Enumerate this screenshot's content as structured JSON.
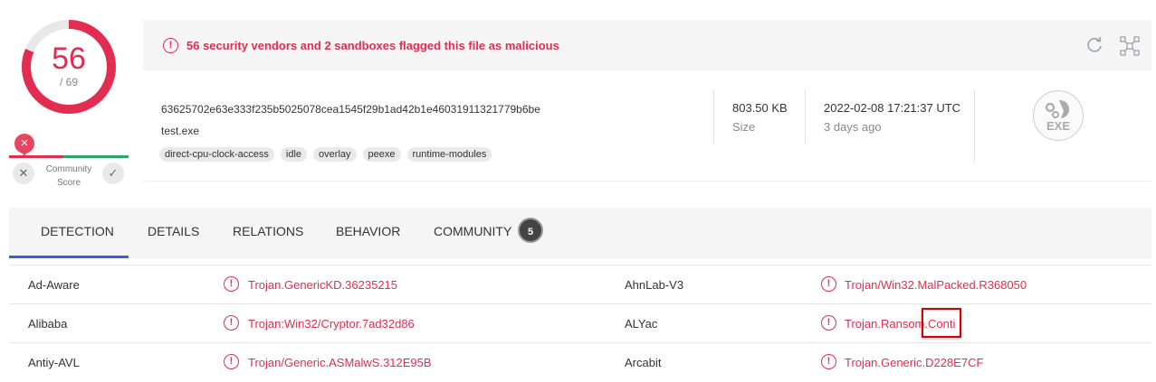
{
  "score": {
    "detections": "56",
    "total": "/ 69",
    "fraction_detected": 0.8116,
    "color": "#e22d51"
  },
  "community": {
    "label_line1": "Community",
    "label_line2": "Score",
    "negative_icon": "x-icon",
    "positive_icon": "check-icon",
    "marker_icon": "x-icon"
  },
  "alert": {
    "text": "56 security vendors and 2 sandboxes flagged this file as malicious",
    "color": "#e22d51"
  },
  "file": {
    "hash": "63625702e63e333f235b5025078cea1545f29b1ad42b1e46031911321779b6be",
    "name": "test.exe",
    "tags": [
      "direct-cpu-clock-access",
      "idle",
      "overlay",
      "peexe",
      "runtime-modules"
    ],
    "size_value": "803.50 KB",
    "size_label": "Size",
    "date_value": "2022-02-08 17:21:37 UTC",
    "date_label": "3 days ago",
    "type_label": "EXE"
  },
  "tabs": [
    {
      "label": "DETECTION",
      "active": true
    },
    {
      "label": "DETAILS"
    },
    {
      "label": "RELATIONS"
    },
    {
      "label": "BEHAVIOR"
    },
    {
      "label": "COMMUNITY",
      "badge": "5"
    }
  ],
  "detections": [
    {
      "vendor": "Ad-Aware",
      "result": "Trojan.GenericKD.36235215",
      "vendor2": "AhnLab-V3",
      "result2": "Trojan/Win32.MalPacked.R368050"
    },
    {
      "vendor": "Alibaba",
      "result": "Trojan:Win32/Cryptor.7ad32d86",
      "vendor2": "ALYac",
      "result2": "Trojan.Ransom.Conti"
    },
    {
      "vendor": "Antiy-AVL",
      "result": "Trojan/Generic.ASMalwS.312E95B",
      "vendor2": "Arcabit",
      "result2": "Trojan.Generic.D228E7CF"
    }
  ]
}
